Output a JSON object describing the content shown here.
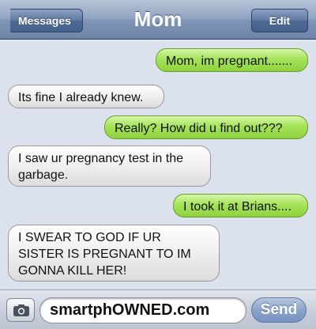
{
  "header": {
    "back_label": "Messages",
    "title": "Mom",
    "edit_label": "Edit"
  },
  "messages": [
    {
      "direction": "sent",
      "text": "Mom, im pregnant......."
    },
    {
      "direction": "received",
      "text": "Its fine I already knew."
    },
    {
      "direction": "sent",
      "text": "Really? How did u find out???"
    },
    {
      "direction": "received",
      "text": "I saw ur pregnancy test in the garbage."
    },
    {
      "direction": "sent",
      "text": "I took it at Brians...."
    },
    {
      "direction": "received",
      "text": "I SWEAR TO GOD IF UR SISTER IS PREGNANT TO IM GONNA KILL HER!"
    }
  ],
  "input": {
    "value": "smartphOWNED.com",
    "send_label": "Send",
    "camera_icon": "camera-icon"
  },
  "colors": {
    "sent_bubble": "#a6e35a",
    "received_bubble": "#efefef",
    "background": "#dbe2ed",
    "header": "#8fa3c1"
  }
}
